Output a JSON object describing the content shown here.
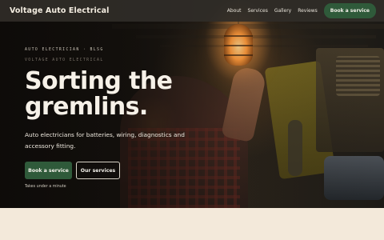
{
  "nav": {
    "brand": "Voltage Auto Electrical",
    "links": [
      "About",
      "Services",
      "Gallery",
      "Reviews"
    ],
    "cta": "Book a service"
  },
  "hero": {
    "eyebrow": "AUTO ELECTRICIAN · BLSG",
    "eyebrow_secondary": "VOLTAGE AUTO ELECTRICAL",
    "headline_line1": "Sorting the",
    "headline_line2": "gremlins.",
    "subtext": "Auto electricians for batteries, wiring, diagnostics and accessory fitting.",
    "primary_button": "Book a service",
    "secondary_button": "Our services",
    "note": "Takes under a minute"
  },
  "colors": {
    "nav_bg": "#302d28",
    "accent_green": "#2f5a3a",
    "headline": "#f6f1e8",
    "bottom_band": "#f3e9da"
  }
}
